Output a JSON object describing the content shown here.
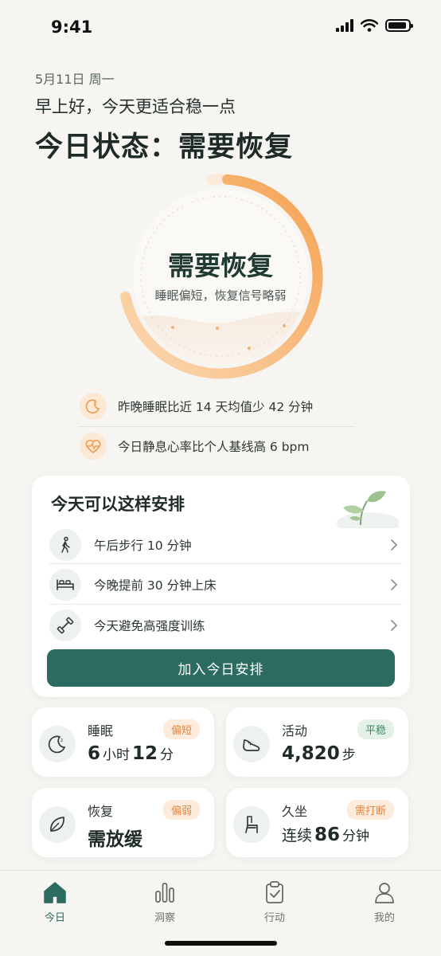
{
  "status_bar": {
    "time": "9:41",
    "battery_level": 0.9
  },
  "header": {
    "date": "5月11日 周一",
    "greeting": "早上好，今天更适合稳一点",
    "title": "今日状态：需要恢复"
  },
  "ring": {
    "state": "需要恢复",
    "subtitle": "睡眠偏短，恢复信号略弱",
    "accent": "#f5a55a"
  },
  "insights": [
    {
      "icon": "moon-icon",
      "text": "昨晚睡眠比近 14 天均值少 42 分钟"
    },
    {
      "icon": "heart-pulse-icon",
      "text": "今日静息心率比个人基线高 6 bpm"
    }
  ],
  "plan": {
    "title": "今天可以这样安排",
    "items": [
      {
        "icon": "walking-icon",
        "label": "午后步行 10 分钟"
      },
      {
        "icon": "bed-icon",
        "label": "今晚提前 30 分钟上床"
      },
      {
        "icon": "dumbbell-icon",
        "label": "今天避免高强度训练"
      }
    ],
    "button_label": "加入今日安排"
  },
  "metrics": [
    {
      "icon": "moon-icon",
      "label": "睡眠",
      "badge": "偏短",
      "badge_tone": "orange",
      "value_parts": [
        "6",
        "小时",
        "12",
        "分"
      ]
    },
    {
      "icon": "shoe-icon",
      "label": "活动",
      "badge": "平稳",
      "badge_tone": "green",
      "value_parts": [
        "4,820",
        "步"
      ]
    },
    {
      "icon": "leaf-icon",
      "label": "恢复",
      "badge": "偏弱",
      "badge_tone": "orange",
      "value_parts": [
        "需放缓"
      ]
    },
    {
      "icon": "chair-icon",
      "label": "久坐",
      "badge": "需打断",
      "badge_tone": "orange",
      "value_parts": [
        "连续",
        "86",
        "分钟"
      ]
    }
  ],
  "tabs": [
    {
      "icon": "home-icon",
      "label": "今日",
      "active": true
    },
    {
      "icon": "bar-chart-icon",
      "label": "洞察",
      "active": false
    },
    {
      "icon": "clipboard-check-icon",
      "label": "行动",
      "active": false
    },
    {
      "icon": "user-icon",
      "label": "我的",
      "active": false
    }
  ],
  "colors": {
    "primary": "#2c6b5f",
    "accent_orange": "#f5a55a",
    "background": "#f6f5f1"
  }
}
